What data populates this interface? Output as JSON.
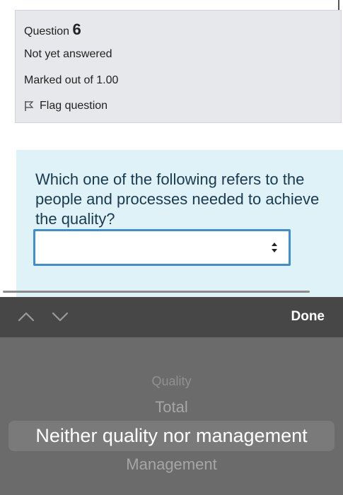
{
  "question": {
    "label": "Question",
    "number": "6",
    "status": "Not yet answered",
    "marks": "Marked out of 1.00",
    "flag_label": "Flag question",
    "text": "Which one of the following refers to the people and processes needed to achieve the quality?"
  },
  "select": {
    "value": ""
  },
  "toolbar": {
    "done_label": "Done"
  },
  "picker": {
    "options": [
      "Quality",
      "Total",
      "Neither quality nor management",
      "Management"
    ],
    "selected_index": 2
  },
  "colors": {
    "info_bg": "#e7e8ec",
    "question_bg": "#def2f8",
    "select_border": "#3e8ed0",
    "toolbar_bg": "#474747",
    "picker_bg": "#6b6b6b"
  }
}
